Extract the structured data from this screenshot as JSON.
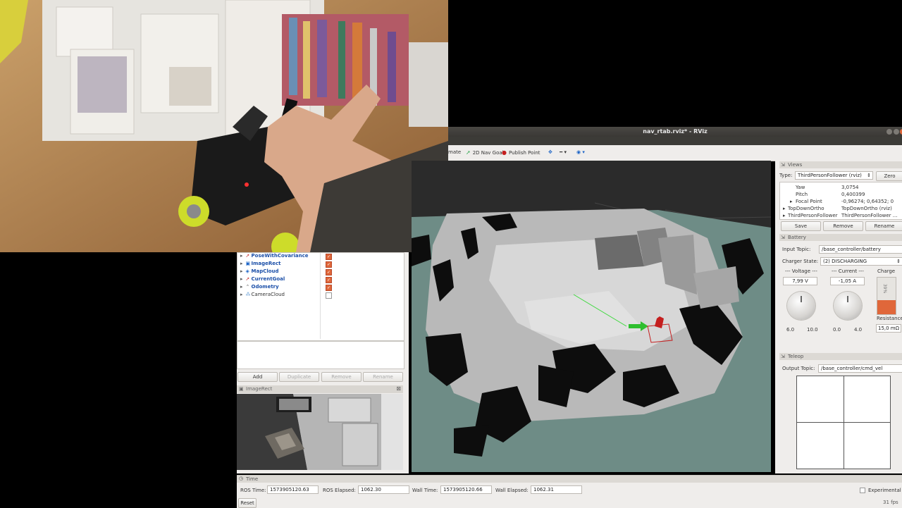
{
  "window": {
    "title": "nav_rtab.rviz* - RViz"
  },
  "toolbar": {
    "items": [
      {
        "label": "mate",
        "icon": "interact-icon"
      },
      {
        "label": "2D Nav Goal",
        "icon": "nav-goal-arrow-icon"
      },
      {
        "label": "Publish Point",
        "icon": "publish-point-pin-icon"
      }
    ]
  },
  "displays": {
    "items": [
      {
        "label": "PoseWithCovariance",
        "checked": true
      },
      {
        "label": "ImageRect",
        "checked": true
      },
      {
        "label": "MapCloud",
        "checked": true
      },
      {
        "label": "CurrentGoal",
        "checked": true
      },
      {
        "label": "Odometry",
        "checked": true
      },
      {
        "label": "CameraCloud",
        "checked": false
      }
    ],
    "buttons": {
      "add": "Add",
      "duplicate": "Duplicate",
      "remove": "Remove",
      "rename": "Rename"
    }
  },
  "image_panel": {
    "title": "ImageRect"
  },
  "views": {
    "header": "Views",
    "type_label": "Type:",
    "type_value": "ThirdPersonFollower (rviz)",
    "zero": "Zero",
    "props": [
      {
        "name": "Yaw",
        "value": "3,0754"
      },
      {
        "name": "Pitch",
        "value": "0,400399"
      },
      {
        "name": "Focal Point",
        "value": "-0,96274; 0,64352; 0"
      }
    ],
    "saved": [
      {
        "name": "TopDownOrtho",
        "value": "TopDownOrtho (rviz)"
      },
      {
        "name": "ThirdPersonFollower",
        "value": "ThirdPersonFollower ..."
      }
    ],
    "save": "Save",
    "remove": "Remove",
    "rename": "Rename"
  },
  "battery": {
    "header": "Battery",
    "input_topic_label": "Input Topic:",
    "input_topic": "/base_controller/battery",
    "charger_label": "Charger State:",
    "charger_state": "(2) DISCHARGING",
    "voltage_label": "--- Voltage ---",
    "voltage": "7,99 V",
    "voltage_min": "6.0",
    "voltage_max": "10.0",
    "current_label": "--- Current ---",
    "current": "-1,05 A",
    "current_min": "0.0",
    "current_max": "4.0",
    "charge_label": "Charge",
    "charge_value": "39%",
    "charge_fraction": 0.39,
    "resistance_label": "Resistance",
    "resistance": "15,0 mΩ"
  },
  "teleop": {
    "header": "Teleop",
    "output_label": "Output Topic:",
    "output_topic": "/base_controller/cmd_vel"
  },
  "time": {
    "header": "Time",
    "ros_time_label": "ROS Time:",
    "ros_time": "1573905120.63",
    "ros_elapsed_label": "ROS Elapsed:",
    "ros_elapsed": "1062.30",
    "wall_time_label": "Wall Time:",
    "wall_time": "1573905120.66",
    "wall_elapsed_label": "Wall Elapsed:",
    "wall_elapsed": "1062.31",
    "experimental": "Experimental",
    "reset": "Reset",
    "fps": "31 fps"
  },
  "colors": {
    "accent": "#e0673a",
    "map_floor": "#6e8c86",
    "goal_arrow": "#2fbf2f",
    "robot_marker": "#c41e1e"
  }
}
